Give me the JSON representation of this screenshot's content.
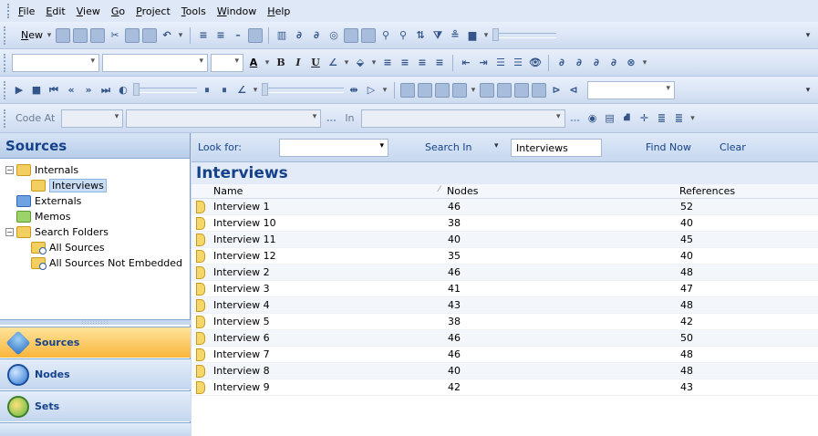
{
  "menubar": {
    "items": [
      {
        "accel": "F",
        "rest": "ile"
      },
      {
        "accel": "E",
        "rest": "dit"
      },
      {
        "accel": "V",
        "rest": "iew"
      },
      {
        "accel": "G",
        "rest": "o"
      },
      {
        "accel": "P",
        "rest": "roject"
      },
      {
        "accel": "T",
        "rest": "ools"
      },
      {
        "accel": "W",
        "rest": "indow"
      },
      {
        "accel": "H",
        "rest": "elp"
      }
    ]
  },
  "toolbar1": {
    "new_accel": "N",
    "new_rest": "ew"
  },
  "toolbar2": {
    "bold": "B",
    "italic": "I",
    "underline": "U",
    "font_color_letter": "A"
  },
  "toolbar4": {
    "code_at_label": "Code At",
    "in_label": "In"
  },
  "sources_panel": {
    "header": "Sources",
    "tree": [
      {
        "label": "Internals",
        "expander": "−",
        "icon": "yellow"
      },
      {
        "label": "Interviews",
        "icon": "yellow",
        "selected": true
      },
      {
        "label": "Externals",
        "icon": "blue"
      },
      {
        "label": "Memos",
        "icon": "green"
      },
      {
        "label": "Search Folders",
        "expander": "−",
        "icon": "yellow"
      },
      {
        "label": "All Sources",
        "icon": "yellow-search"
      },
      {
        "label": "All Sources Not Embedded",
        "icon": "yellow-search"
      }
    ],
    "nav_buttons": [
      {
        "label": "Sources",
        "icon": "sources-icon",
        "active": true
      },
      {
        "label": "Nodes",
        "icon": "nodes-icon",
        "active": false
      },
      {
        "label": "Sets",
        "icon": "sets-icon",
        "active": false
      }
    ]
  },
  "find_bar": {
    "look_for_label": "Look for:",
    "search_in_label": "Search In",
    "search_in_value": "Interviews",
    "find_now_label": "Find Now",
    "clear_label": "Clear"
  },
  "list": {
    "title": "Interviews",
    "columns": {
      "name": "Name",
      "nodes": "Nodes",
      "references": "References"
    },
    "rows": [
      {
        "name": "Interview 1",
        "nodes": "46",
        "references": "52"
      },
      {
        "name": "Interview 10",
        "nodes": "38",
        "references": "40"
      },
      {
        "name": "Interview 11",
        "nodes": "40",
        "references": "45"
      },
      {
        "name": "Interview 12",
        "nodes": "35",
        "references": "40"
      },
      {
        "name": "Interview 2",
        "nodes": "46",
        "references": "48"
      },
      {
        "name": "Interview 3",
        "nodes": "41",
        "references": "47"
      },
      {
        "name": "Interview 4",
        "nodes": "43",
        "references": "48"
      },
      {
        "name": "Interview 5",
        "nodes": "38",
        "references": "42"
      },
      {
        "name": "Interview 6",
        "nodes": "46",
        "references": "50"
      },
      {
        "name": "Interview 7",
        "nodes": "46",
        "references": "48"
      },
      {
        "name": "Interview 8",
        "nodes": "40",
        "references": "48"
      },
      {
        "name": "Interview 9",
        "nodes": "42",
        "references": "43"
      }
    ]
  }
}
